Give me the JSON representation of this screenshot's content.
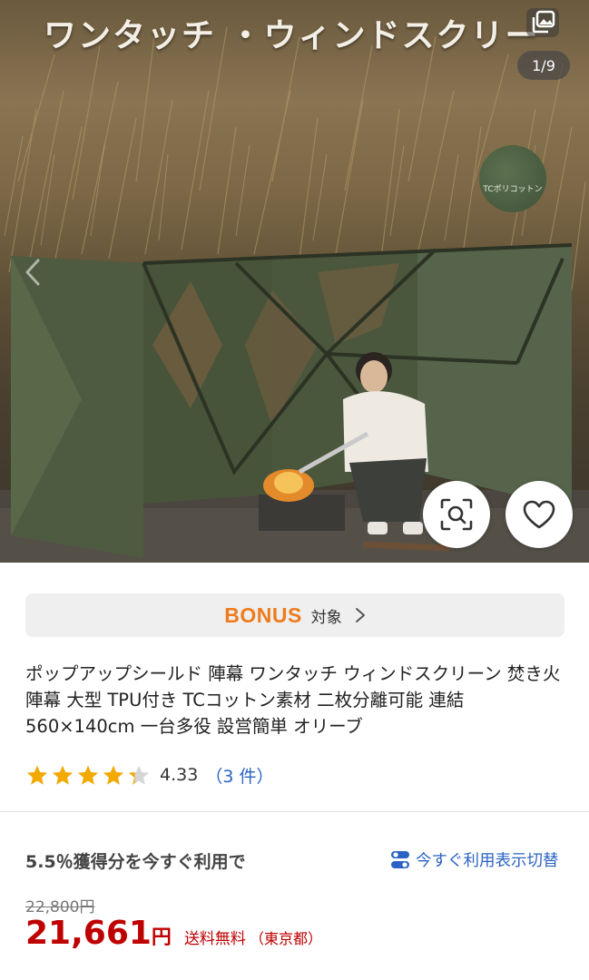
{
  "gallery": {
    "overlay_title": "ワンタッチ ・ウィンドスクリー",
    "counter": "1/9",
    "swatch_label": "TCポリコットン",
    "icons": {
      "gallery": "image-gallery-icon",
      "prev": "chevron-left-icon",
      "lens": "image-search-icon",
      "favorite": "heart-icon"
    }
  },
  "bonus": {
    "logo": "BONUS",
    "label": "対象",
    "icon": "chevron-right-icon"
  },
  "product": {
    "title": "ポップアップシールド 陣幕 ワンタッチ ウィンドスクリーン 焚き火陣幕 大型 TPU付き TCコットン素材 二枚分離可能 連結 560×140cm 一台多役 設営簡単 オリーブ"
  },
  "rating": {
    "stars": 4.33,
    "value": "4.33",
    "count": "（3 件）",
    "star_color": "#f2a900"
  },
  "points": {
    "text": "5.5％獲得分を今すぐ利用で",
    "toggle_label": "今すぐ利用表示切替",
    "toggle_icon": "toggle-icon"
  },
  "price": {
    "original": "22,800円",
    "current": "21,661",
    "currency": "円",
    "shipping": "送料無料",
    "region": "（東京都）",
    "color": "#bf0000"
  }
}
